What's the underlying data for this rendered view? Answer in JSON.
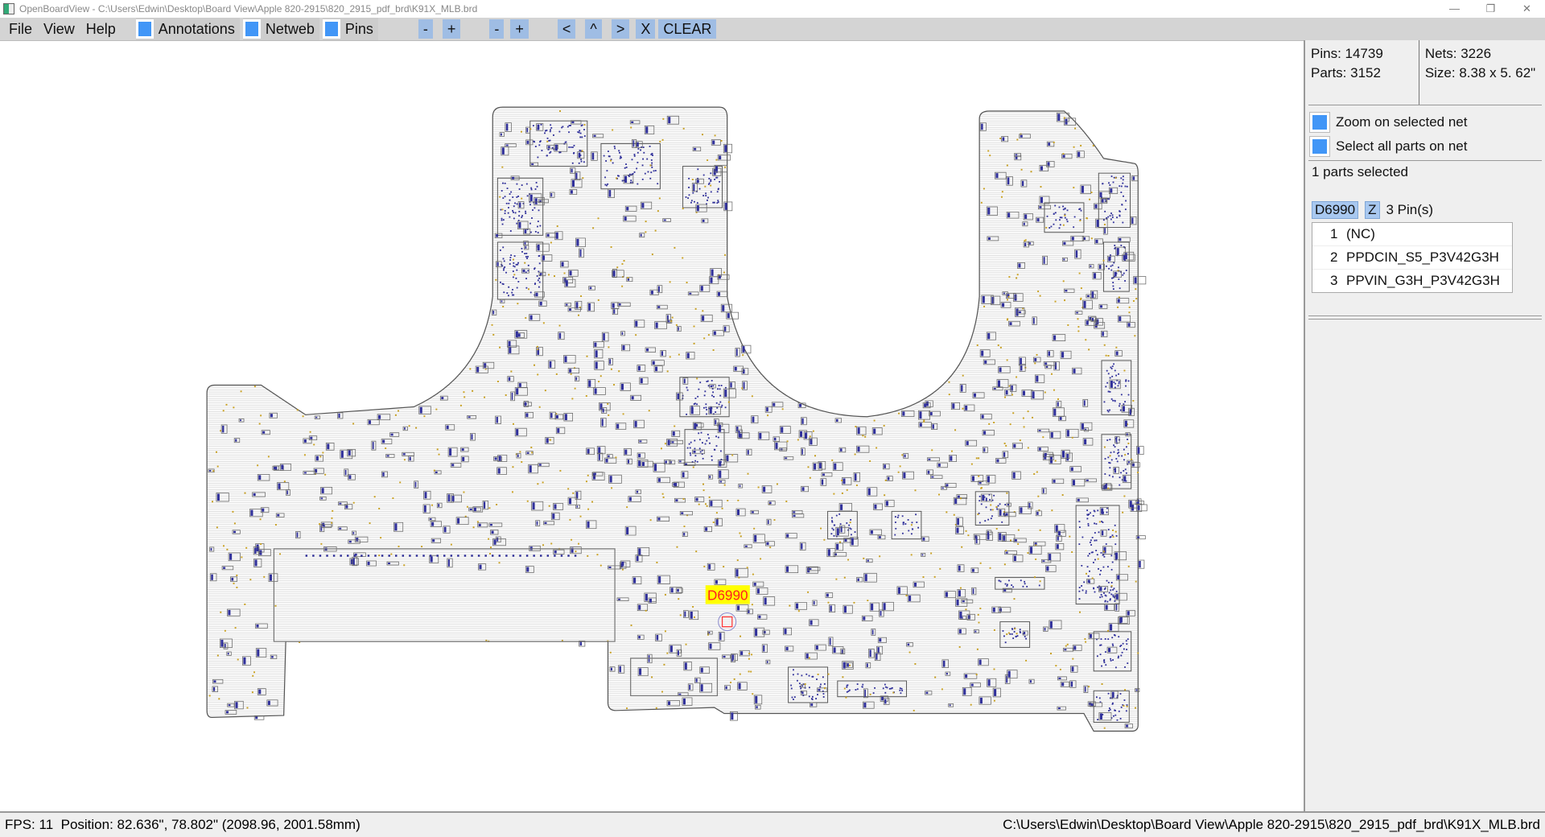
{
  "window": {
    "title": "OpenBoardView - C:\\Users\\Edwin\\Desktop\\Board View\\Apple 820-2915\\820_2915_pdf_brd\\K91X_MLB.brd"
  },
  "menu": [
    "File",
    "View",
    "Help"
  ],
  "toggles": {
    "annotations": "Annotations",
    "netweb": "Netweb",
    "pins": "Pins"
  },
  "toolbar": {
    "zoom_out": "-",
    "zoom_in": "+",
    "zoom_out2": "-",
    "zoom_in2": "+",
    "prev": "<",
    "up": "^",
    "next": ">",
    "x": "X",
    "clear": "CLEAR"
  },
  "board": {
    "highlight_label": "D6990",
    "accent": "#ffff00",
    "label_color": "#ff2020",
    "part_color": "#30309a",
    "pin_color": "#c8a020"
  },
  "panel": {
    "pins": "Pins: 14739",
    "parts": "Parts: 3152",
    "nets": "Nets: 3226",
    "size": "Size: 8.38 x 5. 62\"",
    "zoom_on_net": "Zoom on selected net",
    "select_all_parts": "Select all parts on net",
    "parts_selected": "1 parts selected",
    "selected_part": "D6990",
    "z_button": "Z",
    "pin_count": "3 Pin(s)",
    "pin_list": [
      {
        "num": "1",
        "net": "(NC)"
      },
      {
        "num": "2",
        "net": "PPDCIN_S5_P3V42G3H"
      },
      {
        "num": "3",
        "net": "PPVIN_G3H_P3V42G3H"
      }
    ]
  },
  "status": {
    "fps": "FPS: 11",
    "position": "Position: 82.636\", 78.802\" (2098.96, 2001.58mm)",
    "file_path": "C:\\Users\\Edwin\\Desktop\\Board View\\Apple 820-2915\\820_2915_pdf_brd\\K91X_MLB.brd"
  }
}
